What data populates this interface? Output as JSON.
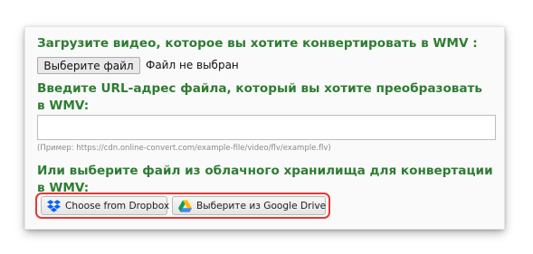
{
  "upload": {
    "heading": "Загрузите видео, которое вы хотите конвертировать в WMV :",
    "choose_file_label": "Выберите файл",
    "file_status": "Файл не выбран"
  },
  "url": {
    "heading": "Введите URL-адрес файла, который вы хотите преобразовать в WMV:",
    "value": "",
    "example": "(Пример: https://cdn.online-convert.com/example-file/video/flv/example.flv)"
  },
  "cloud": {
    "heading": "Или выберите файл из облачного хранилища для конвертации в WMV:",
    "dropbox_label": "Choose from Dropbox",
    "gdrive_label": "Выберите из Google Drive"
  },
  "colors": {
    "heading_green": "#2e7d32",
    "highlight_red": "#e53935",
    "dropbox_blue": "#0061fe"
  },
  "icons": {
    "dropbox": "dropbox-icon",
    "google_drive": "google-drive-icon"
  }
}
